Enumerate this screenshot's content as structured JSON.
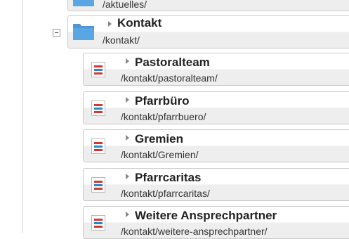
{
  "tree": {
    "aktuelles": {
      "path": "/aktuelles/"
    },
    "kontakt": {
      "title": "Kontakt",
      "path": "/kontakt/"
    },
    "children": [
      {
        "title": "Pastoralteam",
        "path": "/kontakt/pastoralteam/"
      },
      {
        "title": "Pfarrbüro",
        "path": "/kontakt/pfarrbuero/"
      },
      {
        "title": "Gremien",
        "path": "/kontakt/Gremien/"
      },
      {
        "title": "Pfarrcaritas",
        "path": "/kontakt/pfarrcaritas/"
      },
      {
        "title": "Weitere Ansprechpartner",
        "path": "/kontakt/weitere-ansprechpartner/"
      }
    ]
  },
  "colors": {
    "folder": "#4a98d8",
    "page_icon_red": "#d7362f",
    "page_icon_blue": "#2a88c8"
  }
}
